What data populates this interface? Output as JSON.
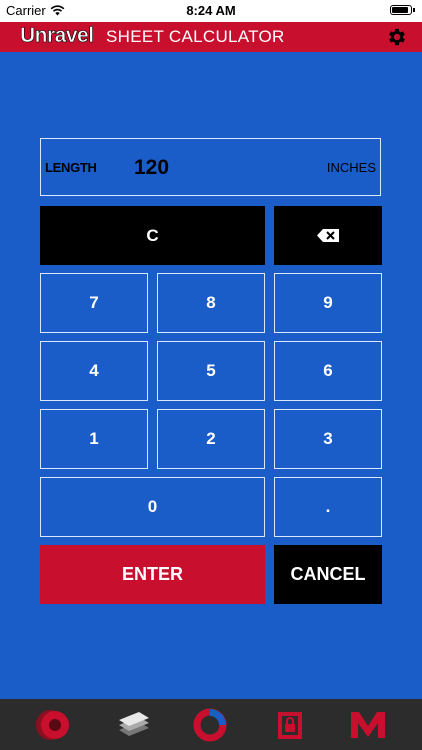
{
  "status": {
    "carrier": "Carrier",
    "time": "8:24 AM"
  },
  "header": {
    "brand": "Unravel",
    "title": "SHEET CALCULATOR"
  },
  "display": {
    "label": "LENGTH",
    "value": "120",
    "unit": "INCHES"
  },
  "keys": {
    "clear": "C",
    "seven": "7",
    "eight": "8",
    "nine": "9",
    "four": "4",
    "five": "5",
    "six": "6",
    "one": "1",
    "two": "2",
    "three": "3",
    "zero": "0",
    "decimal": ".",
    "enter": "ENTER",
    "cancel": "CANCEL"
  },
  "icons": {
    "settings": "gear-icon",
    "backspace": "backspace-icon",
    "tabs": [
      "roll-icon",
      "sheets-icon",
      "ring-icon",
      "lock-box-icon",
      "m-logo-icon"
    ]
  },
  "colors": {
    "background": "#1a5dc8",
    "accent": "#c8102e",
    "tabbar": "#2c2c2c"
  }
}
